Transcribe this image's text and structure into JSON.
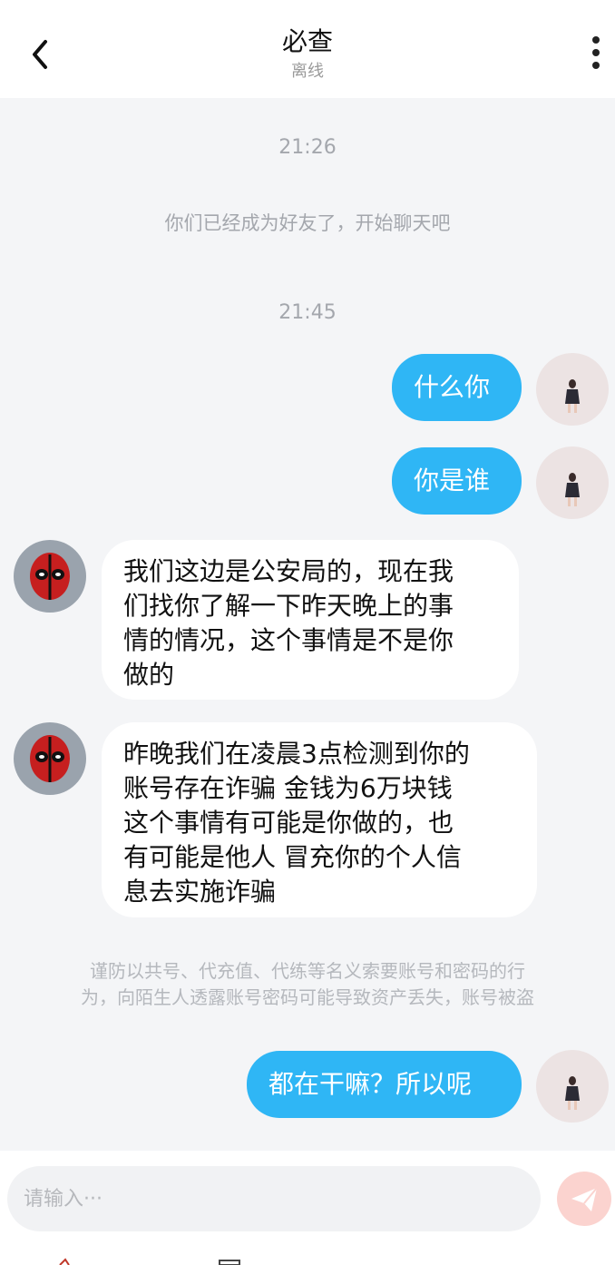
{
  "header": {
    "title": "必查",
    "status": "离线"
  },
  "messages": [
    {
      "type": "time",
      "text": "21:26"
    },
    {
      "type": "system",
      "text": "你们已经成为好友了，开始聊天吧"
    },
    {
      "type": "time",
      "text": "21:45"
    },
    {
      "type": "sent",
      "text": "什么你"
    },
    {
      "type": "sent",
      "text": "你是谁"
    },
    {
      "type": "received",
      "lines": [
        "我们这边是公安局的，现在我",
        "们找你了解一下昨天晚上的事",
        "情的情况，这个事情是不是你",
        "做的"
      ]
    },
    {
      "type": "received",
      "lines": [
        "昨晚我们在凌晨3点检测到你的",
        "账号存在诈骗 金钱为6万块钱",
        "这个事情有可能是你做的，也",
        "有可能是他人 冒充你的个人信",
        "息去实施诈骗"
      ]
    },
    {
      "type": "warning",
      "lines": [
        "谨防以共号、代充值、代练等名义索要账号和密码的行",
        "为，向陌生人透露账号密码可能导致资产丢失，账号被盗"
      ]
    },
    {
      "type": "sent",
      "text": "都在干嘛？所以呢"
    }
  ],
  "input": {
    "placeholder": "请输入···"
  },
  "colors": {
    "accent": "#2fb6f5",
    "background": "#f4f5f7",
    "send_button": "#fbd3cf"
  }
}
